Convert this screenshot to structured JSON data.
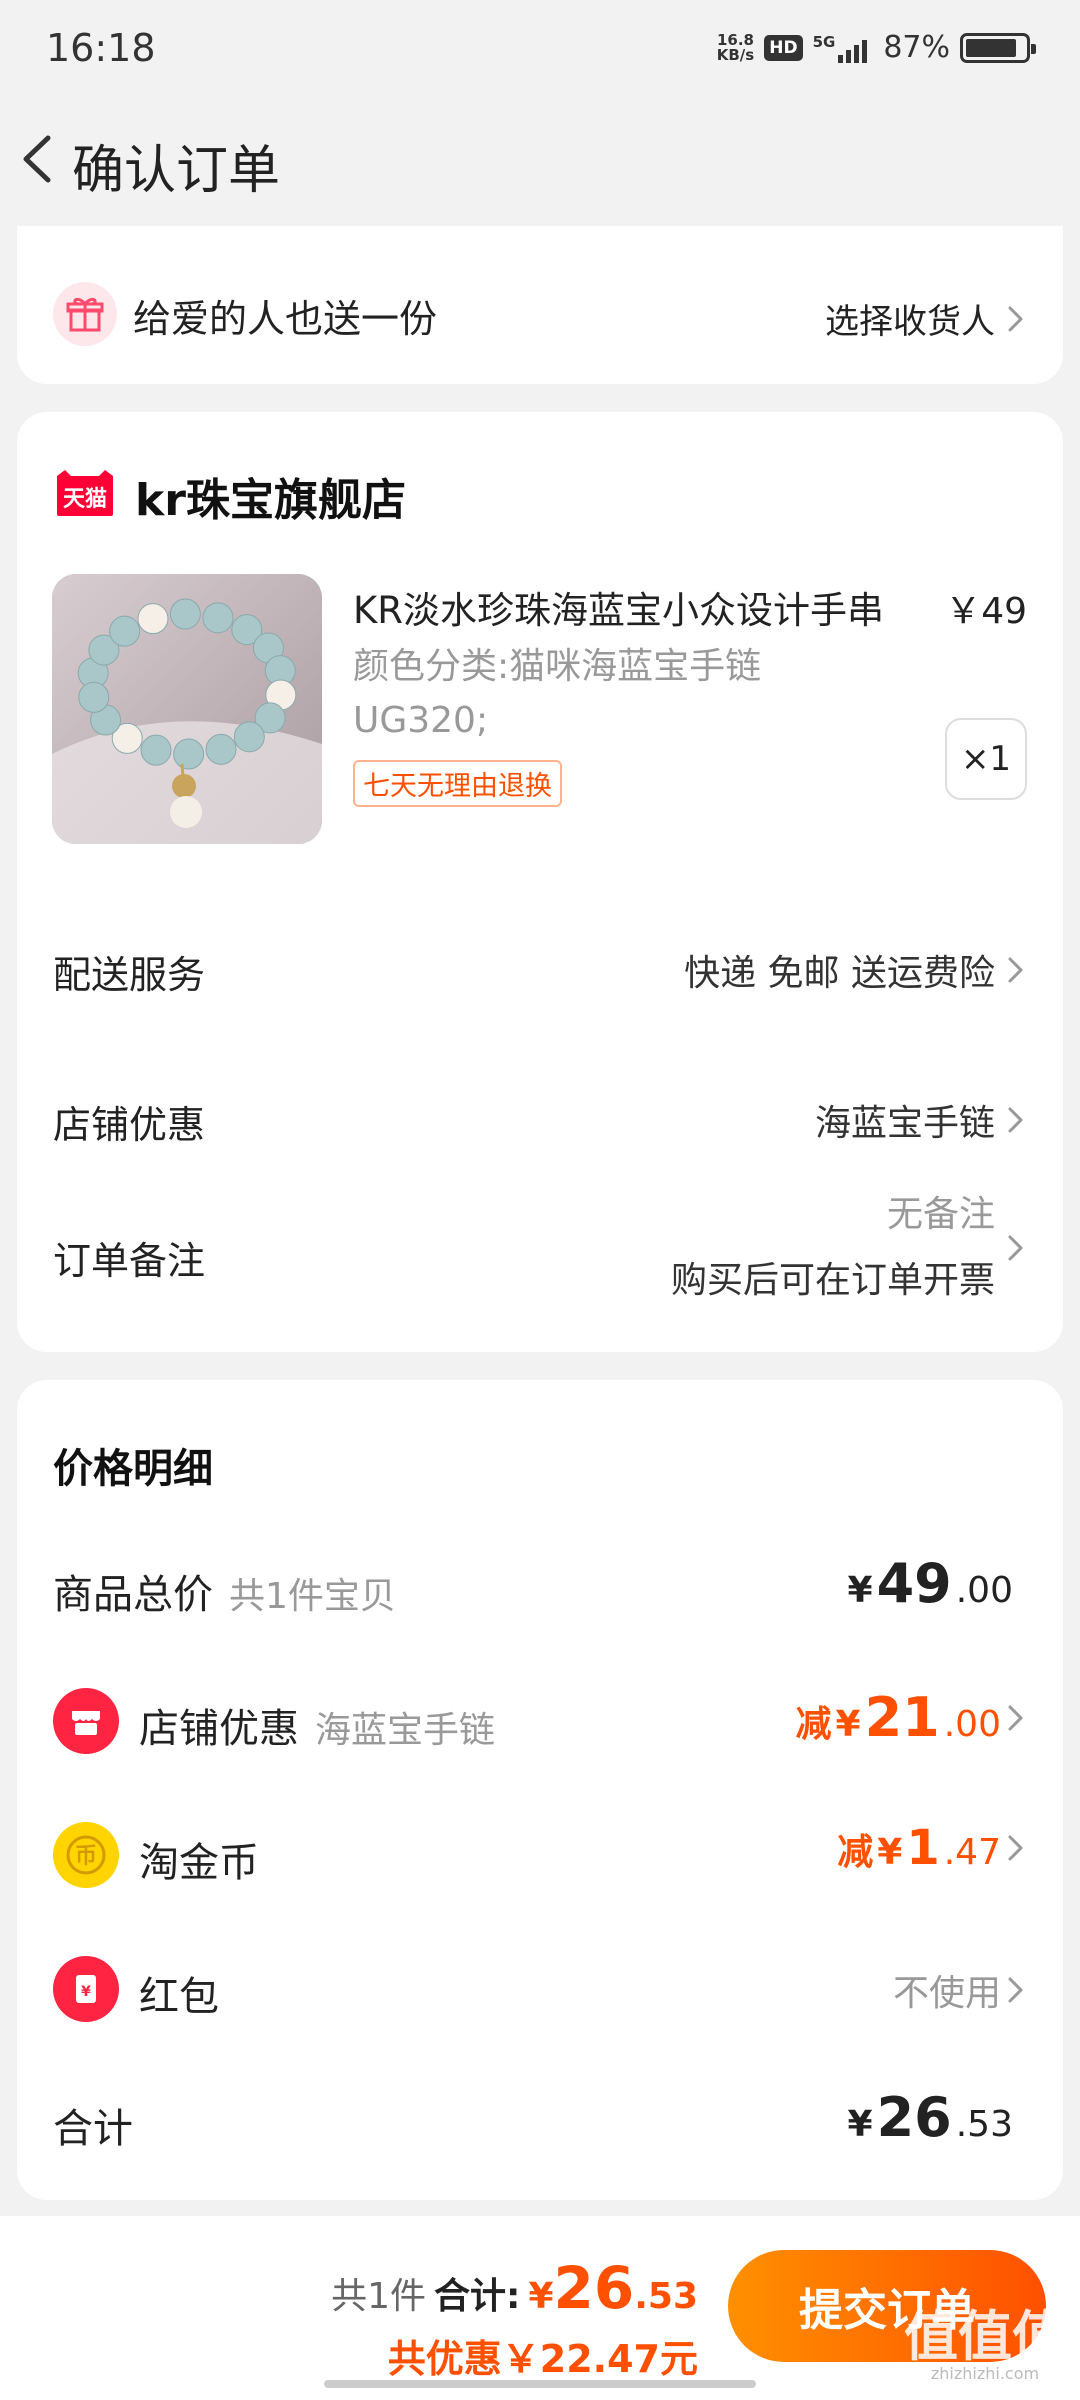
{
  "status_bar": {
    "time": "16:18",
    "speed_value": "16.8",
    "speed_unit": "KB/s",
    "hd": "HD",
    "network": "5G",
    "battery": "87%",
    "battery_level": 0.87
  },
  "nav": {
    "back_icon": "chevron-left-icon",
    "title": "确认订单"
  },
  "gift": {
    "text": "给爱的人也送一份",
    "action": "选择收货人"
  },
  "order": {
    "store_badge": "天猫",
    "store_name": "kr珠宝旗舰店",
    "product": {
      "title": "KR淡水珍珠海蓝宝小众设计手串",
      "price": "￥49",
      "spec_line1": "颜色分类:猫咪海蓝宝手链",
      "spec_line2": "UG320;",
      "tag": "七天无理由退换",
      "quantity": "×1"
    },
    "rows": {
      "delivery_label": "配送服务",
      "delivery_value": "快递 免邮 送运费险",
      "store_discount_label": "店铺优惠",
      "store_discount_value": "海蓝宝手链",
      "remark_label": "订单备注",
      "remark_value_line1": "无备注",
      "remark_value_line2": "购买后可在订单开票"
    }
  },
  "price_detail": {
    "title": "价格明细",
    "goods_total": {
      "label": "商品总价",
      "sub": "共1件宝贝",
      "currency": "¥",
      "int": "49",
      "dec": ".00"
    },
    "store_discount": {
      "label": "店铺优惠",
      "sub": "海蓝宝手链",
      "prefix": "减",
      "currency": "¥",
      "int": "21",
      "dec": ".00"
    },
    "coins": {
      "label": "淘金币",
      "prefix": "减",
      "currency": "¥",
      "int": "1",
      "dec": ".47"
    },
    "red_packet": {
      "label": "红包",
      "value": "不使用"
    },
    "total": {
      "label": "合计",
      "currency": "¥",
      "int": "26",
      "dec": ".53"
    }
  },
  "bottom_bar": {
    "count": "共1件",
    "total_label": "合计:",
    "currency": "¥",
    "int": "26",
    "dec": ".53",
    "saved": "共优惠￥22.47元",
    "submit": "提交订单",
    "watermark": "值值值",
    "watermark_site": "zhizhizhi.com"
  },
  "colors": {
    "accent": "#ff5000",
    "background": "#f2f2f2",
    "tmall_red": "#ff0036"
  }
}
